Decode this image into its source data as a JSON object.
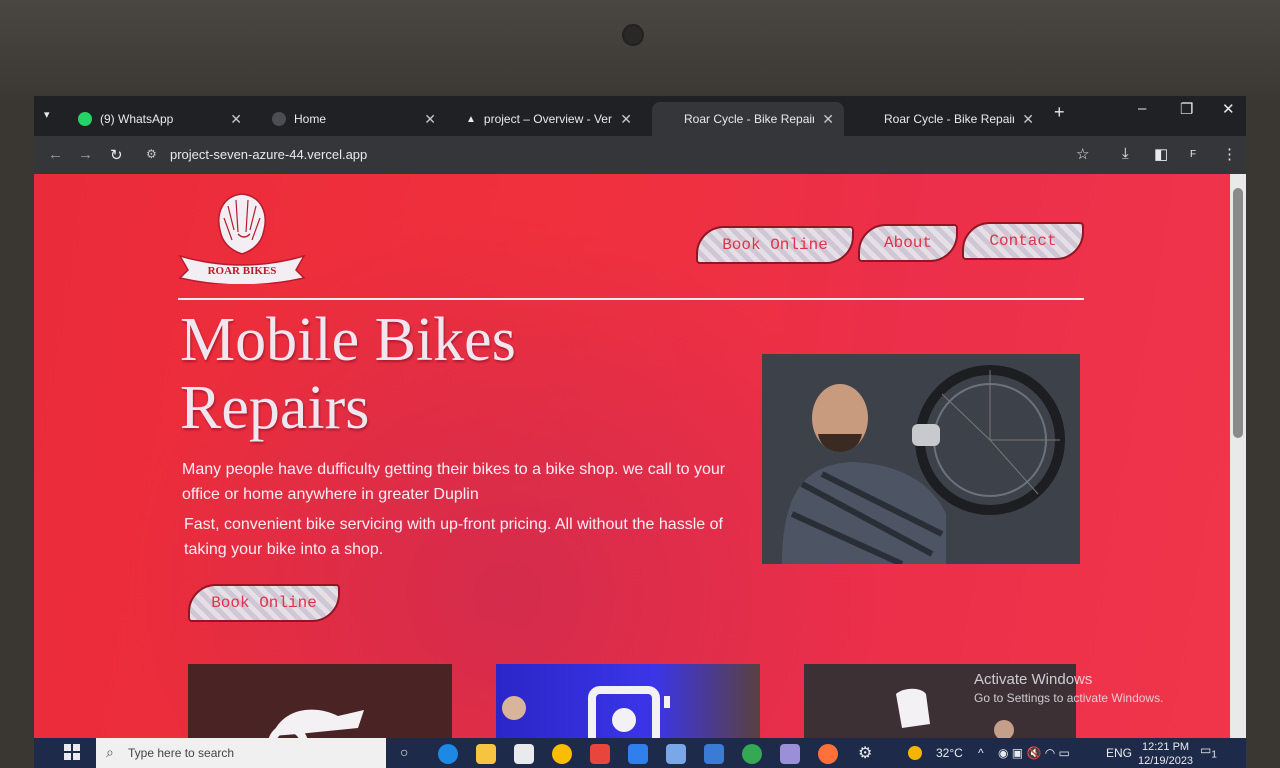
{
  "tabs": [
    {
      "title": "(9) WhatsApp",
      "icon": "whatsapp-icon",
      "color": "#25d366"
    },
    {
      "title": "Home",
      "icon": "globe-icon",
      "color": "#4a4d52"
    },
    {
      "title": "project – Overview - Vercel",
      "icon": "vercel-icon",
      "color": "#e8eaed"
    },
    {
      "title": "Roar Cycle - Bike Repair in F",
      "icon": "page-icon",
      "color": "#4a4d52"
    },
    {
      "title": "Roar Cycle - Bike Repair in F",
      "icon": "page-icon",
      "color": "#4a4d52"
    }
  ],
  "browser": {
    "url": "project-seven-azure-44.vercel.app",
    "profile_initial": "F"
  },
  "site": {
    "logo_text": "ROAR BIKES",
    "nav": [
      "Book Online",
      "About",
      "Contact"
    ],
    "hero_title": "Mobile Bikes Repairs",
    "paragraph1": "Many people have dufficulty getting their bikes to a bike shop. we call to your office or home anywhere in greater Duplin",
    "paragraph2": "Fast, convenient bike servicing with up-front pricing. All without the hassle of taking your bike into a shop.",
    "cta": "Book Online",
    "accent_color": "#ee2e3c"
  },
  "watermark": {
    "title": "Activate Windows",
    "subtitle": "Go to Settings to activate Windows."
  },
  "taskbar": {
    "search_placeholder": "Type here to search",
    "temperature": "32°C",
    "language": "ENG",
    "time": "12:21 PM",
    "date": "12/19/2023",
    "notification_count": "1"
  }
}
